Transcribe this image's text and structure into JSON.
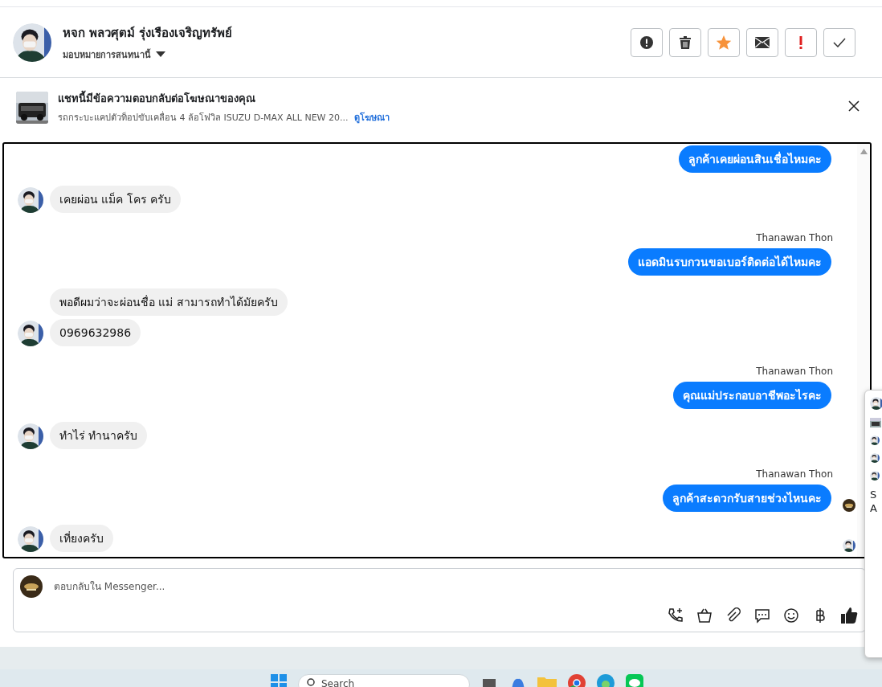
{
  "header": {
    "name": "หจก พลวศุตม์ รุ่งเรืองเจริญทรัพย์",
    "assign_label": "มอบหมายการสนทนานี้",
    "actions": [
      {
        "kind": "alert"
      },
      {
        "kind": "trash"
      },
      {
        "kind": "star",
        "on": true
      },
      {
        "kind": "mail"
      },
      {
        "kind": "important"
      },
      {
        "kind": "done"
      }
    ]
  },
  "ad_banner": {
    "title": "แชทนี้มีข้อความตอบกลับต่อโฆษณาของคุณ",
    "description": "รถกระบะแคปตัวท็อปขับเคลื่อน 4 ล้อโฟวิล ISUZU D-MAX ALL NEW 20...",
    "link": "ดูโฆษณา"
  },
  "messages": [
    {
      "kind": "out",
      "text": "ลูกค้าเคยผ่อนสินเชื่อไหมคะ"
    },
    {
      "kind": "in",
      "text": "เคยผ่อน แม็ค โคร ครับ",
      "avatar": true
    },
    {
      "kind": "out",
      "sender": "Thanawan Thon",
      "text": "แอดมินรบกวนขอเบอร์ติดต่อได้ไหมคะ"
    },
    {
      "kind": "in",
      "text": "พอดีผมว่าจะผ่อนชื่อ แม่ สามารถทำได้มัยครับ",
      "avatar": false
    },
    {
      "kind": "in",
      "text": "0969632986",
      "avatar": true
    },
    {
      "kind": "out",
      "sender": "Thanawan Thon",
      "text": "คุณแม่ประกอบอาชีพอะไรคะ"
    },
    {
      "kind": "in",
      "text": "ทำไร่ ทำนาครับ",
      "avatar": true
    },
    {
      "kind": "out",
      "sender": "Thanawan Thon",
      "text": "ลูกค้าสะดวกรับสายช่วงไหนคะ",
      "seen": true
    },
    {
      "kind": "in",
      "text": "เที่ยงครับ",
      "avatar": true,
      "seen": true
    }
  ],
  "composer": {
    "placeholder": "ตอบกลับใน Messenger..."
  },
  "side_popup": {
    "line_1": "S",
    "line_2": "A"
  },
  "taskbar": {
    "search_placeholder": "Search"
  }
}
